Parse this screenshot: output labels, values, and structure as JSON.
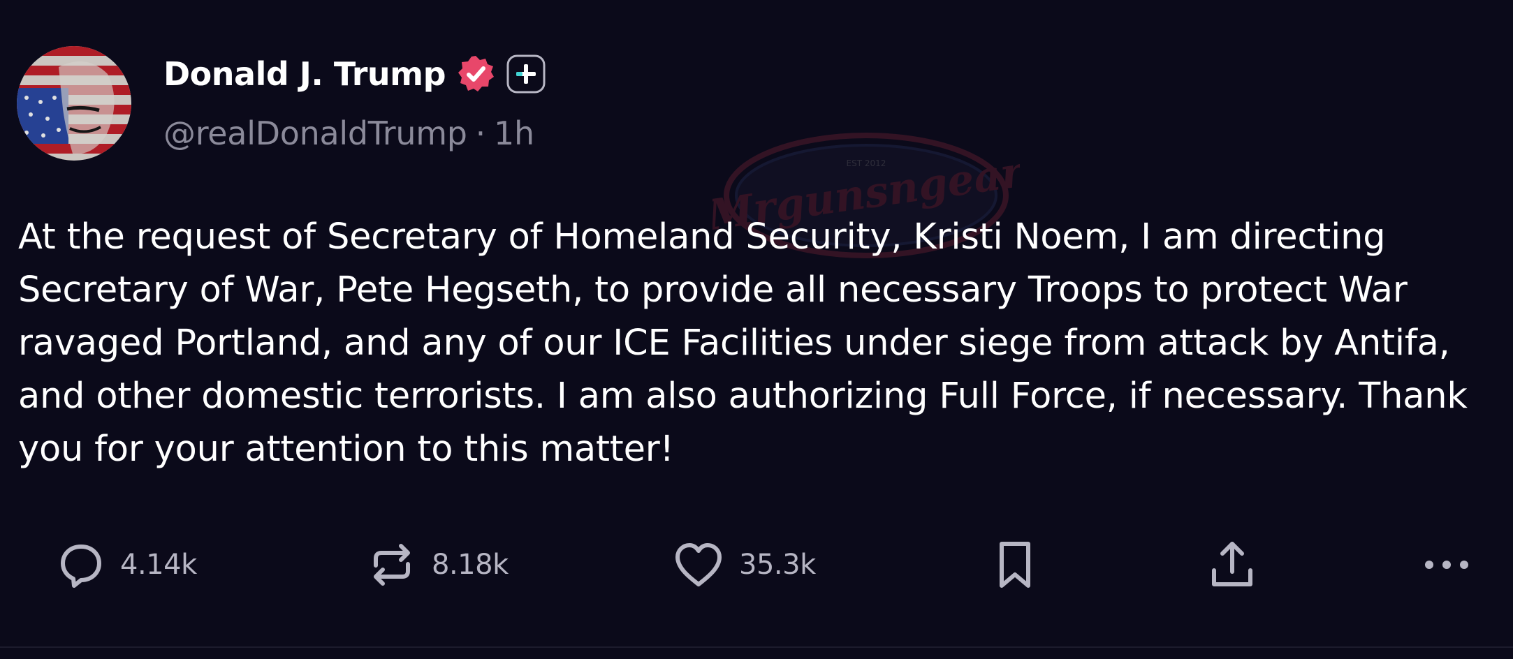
{
  "author": {
    "display_name": "Donald J. Trump",
    "handle": "@realDonaldTrump",
    "separator": "·",
    "time_ago": "1h",
    "avatar_icon": "flag-face-avatar-icon",
    "verified_icon": "verified-badge-icon",
    "plus_icon": "plus-badge-icon"
  },
  "post": {
    "text": "At the request of Secretary of Homeland Security, Kristi Noem, I am directing Secretary of War, Pete Hegseth, to provide all necessary Troops to protect War ravaged Portland, and any of our ICE Facilities under siege from attack by Antifa, and other domestic terrorists. I am also authorizing Full Force, if necessary. Thank you for your attention to this matter!"
  },
  "watermark": {
    "text": "Mrgunsngear",
    "small_top": "EST 2012"
  },
  "actions": {
    "reply_count": "4.14k",
    "repost_count": "8.18k",
    "like_count": "35.3k",
    "reply_icon": "comment-bubble-icon",
    "repost_icon": "repost-arrows-icon",
    "like_icon": "heart-icon",
    "bookmark_icon": "bookmark-icon",
    "share_icon": "share-upload-icon",
    "more_icon": "more-dots-icon"
  },
  "colors": {
    "background": "#0b0a1a",
    "text_primary": "#ffffff",
    "text_secondary": "#8b8a9a",
    "icon": "#b7b6c4",
    "verified_badge": "#e8476a"
  }
}
